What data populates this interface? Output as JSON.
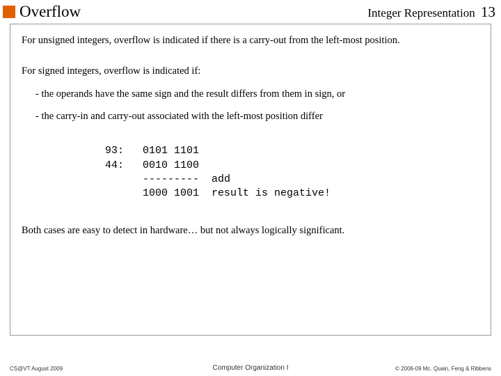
{
  "header": {
    "title": "Overflow",
    "section": "Integer Representation",
    "slide_number": "13"
  },
  "body": {
    "unsigned": "For unsigned integers, overflow is indicated if there is a carry-out from the left-most position.",
    "signed_intro": "For signed integers, overflow is indicated if:",
    "bullet1": "-   the operands have the same sign and the result differs from them in sign, or",
    "bullet2": "-   the carry-in and carry-out associated with the left-most position differ",
    "mono": "93:   0101 1101\n44:   0010 1100\n      ---------  add\n      1000 1001  result is negative!",
    "closing": "Both cases are easy to detect in hardware… but not always logically significant."
  },
  "footer": {
    "left": "CS@VT August 2009",
    "center": "Computer Organization I",
    "right": "© 2006-09  Mc. Quain, Feng & Ribbens"
  }
}
